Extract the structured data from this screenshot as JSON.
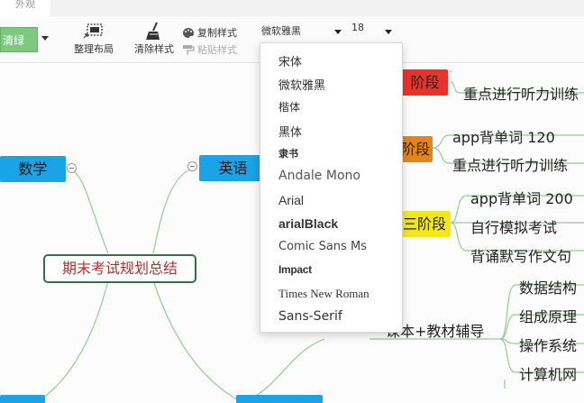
{
  "tabbar": {
    "active_tab": "外观"
  },
  "toolbar": {
    "theme_label": "清绿",
    "arrange_label": "整理布局",
    "clear_style_label": "清除样式",
    "copy_style_label": "复制样式",
    "paste_style_label": "粘贴样式",
    "font_family_value": "微软雅黑",
    "font_size_value": "18"
  },
  "font_menu": {
    "items": [
      "宋体",
      "微软雅黑",
      "楷体",
      "黑体",
      "隶书",
      "Andale Mono",
      "Arial",
      "arialBlack",
      "Comic Sans Ms",
      "Impact",
      "Times New Roman",
      "Sans-Serif"
    ]
  },
  "mindmap": {
    "root": "期末考试规划总结",
    "subjects": {
      "math": "数学",
      "english": "英语"
    },
    "stages": {
      "second": "阶段",
      "third": "三阶段"
    },
    "leaves": {
      "l1": "重点进行听力训练",
      "l2": "app背单词  120",
      "l3": "重点进行听力训练",
      "l4": "app背单词 200",
      "l5": "自行模拟考试",
      "l6": "背诵默写作文句",
      "l7": "课本+教材辅导",
      "l8": "数据结构",
      "l9": "组成原理",
      "l10": "操作系统",
      "l11": "计算机网"
    }
  },
  "colors": {
    "accent_green": "#7cc97f",
    "subject_blue": "#1aa3e6",
    "stage_red": "#e8332a",
    "stage_orange": "#e8831a",
    "stage_yellow": "#f5e81a",
    "line_green": "#8fcf8f",
    "root_text": "#b0302c",
    "root_border": "#3d6b4a"
  }
}
